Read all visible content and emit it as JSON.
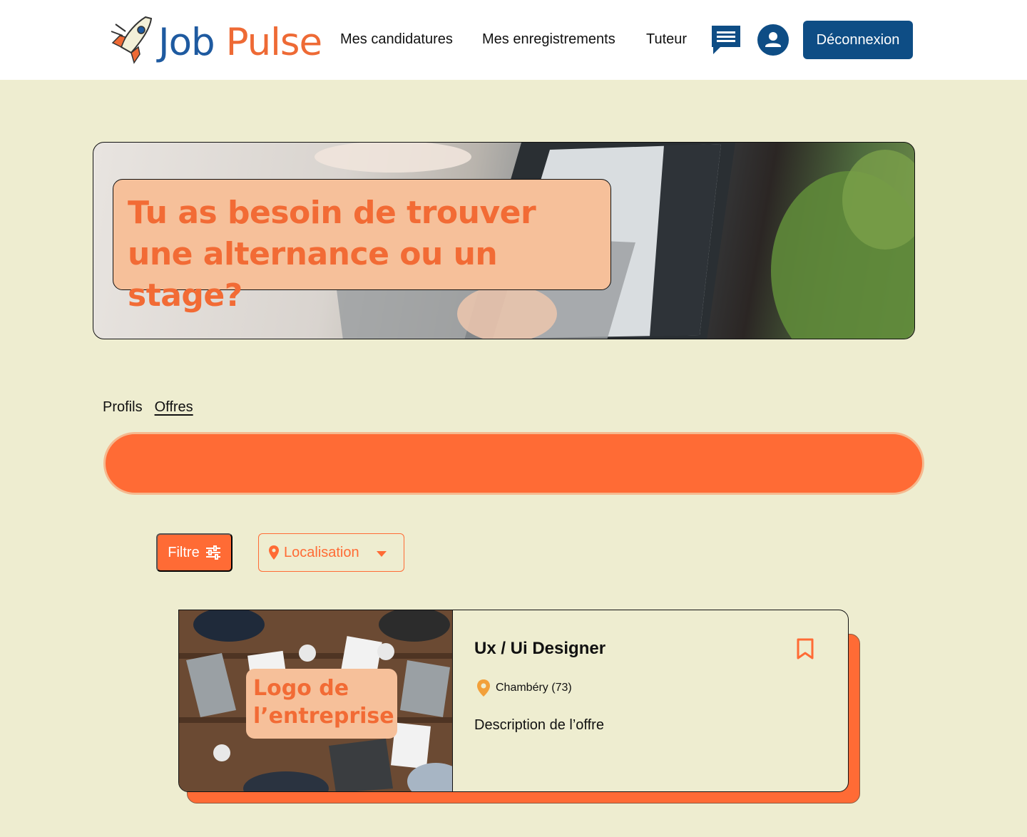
{
  "brand": {
    "part1": "Job",
    "part2": "Pulse"
  },
  "nav": {
    "applications": "Mes candidatures",
    "saved": "Mes enregistrements",
    "tutor": "Tuteur",
    "logout": "Déconnexion"
  },
  "hero": {
    "title": "Tu as besoin de trouver une alternance ou un stage?"
  },
  "tabs": {
    "profiles": "Profils",
    "offers": "Offres",
    "active": "Offres"
  },
  "filters": {
    "filter_label": "Filtre",
    "location_label": "Localisation"
  },
  "offer": {
    "logo_placeholder": "Logo de l’entreprise",
    "title": "Ux / Ui Designer",
    "location": "Chambéry (73)",
    "description": "Description de l’offre"
  },
  "colors": {
    "accent": "#FF6B35",
    "primary": "#0E4D85",
    "background": "#EEEDD0",
    "peach": "#F6C09A"
  },
  "icons": [
    "rocket-logo-icon",
    "chat-icon",
    "user-icon",
    "sliders-icon",
    "location-pin-icon",
    "caret-down-icon",
    "bookmark-icon"
  ]
}
